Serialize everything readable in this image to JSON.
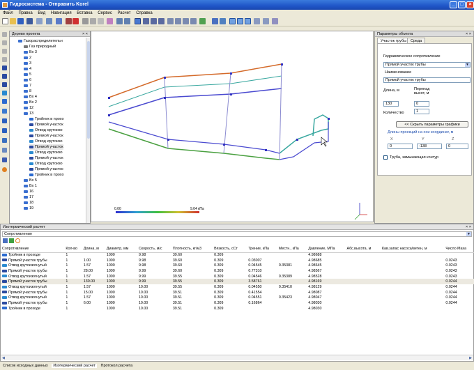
{
  "app": {
    "title": "Гидросистема - Отправить Korel",
    "menu": [
      "Файл",
      "Правка",
      "Вид",
      "Навигация",
      "Вставка",
      "Сервис",
      "Расчет",
      "Справка"
    ]
  },
  "colors": {
    "pipe_orange": "#d46a2a",
    "pipe_blue": "#4a4ad0",
    "pipe_teal": "#3aa8a0",
    "pipe_green": "#4aa040",
    "node": "#3030c0"
  },
  "tree": {
    "title": "Дерево проекта",
    "items": [
      {
        "label": "Газораспределительн",
        "icon": "network-icon",
        "color": "#3a6fd0"
      },
      {
        "label": "Газ природный",
        "icon": "gas-icon",
        "color": "#777"
      },
      {
        "label": "Вх 3",
        "icon": "branch-icon",
        "color": "#3a6fd0"
      },
      {
        "label": "2",
        "icon": "branch-icon",
        "color": "#3a6fd0"
      },
      {
        "label": "3",
        "icon": "branch-icon",
        "color": "#3a6fd0"
      },
      {
        "label": "4",
        "icon": "branch-icon",
        "color": "#3a6fd0"
      },
      {
        "label": "5",
        "icon": "branch-icon",
        "color": "#3a6fd0"
      },
      {
        "label": "6",
        "icon": "branch-icon",
        "color": "#3a6fd0"
      },
      {
        "label": "7",
        "icon": "branch-icon",
        "color": "#3a6fd0"
      },
      {
        "label": "8",
        "icon": "branch-icon",
        "color": "#3a6fd0"
      },
      {
        "label": "Вх 4",
        "icon": "branch-icon",
        "color": "#3a6fd0"
      },
      {
        "label": "Вх 2",
        "icon": "branch-icon",
        "color": "#3a6fd0"
      },
      {
        "label": "12",
        "icon": "branch-icon",
        "color": "#3a6fd0"
      },
      {
        "label": "13",
        "icon": "branch-icon",
        "color": "#3a6fd0"
      },
      {
        "label": "Тройник в прохо",
        "icon": "tee-icon",
        "color": "#2a6ad0"
      },
      {
        "label": "Прямой участок",
        "icon": "pipe-icon",
        "color": "#2a4aa0"
      },
      {
        "label": "Отвод крутоизо",
        "icon": "elbow-icon",
        "color": "#2a8ad0"
      },
      {
        "label": "Прямой участок",
        "icon": "pipe-icon",
        "color": "#2a4aa0"
      },
      {
        "label": "Отвод крутоизо",
        "icon": "elbow-icon",
        "color": "#2a8ad0"
      },
      {
        "label": "Прямой участок",
        "icon": "pipe-icon",
        "color": "#2a4aa0"
      },
      {
        "label": "Отвод крутоизо",
        "icon": "elbow-icon",
        "color": "#2a8ad0"
      },
      {
        "label": "Прямой участок",
        "icon": "pipe-icon",
        "color": "#2a4aa0"
      },
      {
        "label": "Отвод крутоизо",
        "icon": "elbow-icon",
        "color": "#2a8ad0"
      },
      {
        "label": "Прямой участок",
        "icon": "pipe-icon",
        "color": "#2a4aa0"
      },
      {
        "label": "Тройник в прохо",
        "icon": "tee-icon",
        "color": "#2a6ad0"
      },
      {
        "label": "Вх 5",
        "icon": "branch-icon",
        "color": "#3a6fd0"
      },
      {
        "label": "Вх 1",
        "icon": "branch-icon",
        "color": "#3a6fd0"
      },
      {
        "label": "16",
        "icon": "branch-icon",
        "color": "#3a6fd0"
      },
      {
        "label": "17",
        "icon": "branch-icon",
        "color": "#3a6fd0"
      },
      {
        "label": "18",
        "icon": "branch-icon",
        "color": "#3a6fd0"
      },
      {
        "label": "19",
        "icon": "branch-icon",
        "color": "#3a6fd0"
      }
    ]
  },
  "canvas": {
    "legend_min": "0.00",
    "legend_max": "9.04 кПа"
  },
  "props": {
    "title": "Параметры объекта",
    "tabs": [
      "Участок трубы",
      "Среда"
    ],
    "hydraulic_label": "Гидравлическое сопротивление",
    "hydraulic_value": "Прямой участок трубы",
    "name_label": "Наименование",
    "name_value": "Прямой участок трубы",
    "length_label": "Длина, м",
    "length_value": "130",
    "height_label": "Перепад высот, м",
    "height_value": "0",
    "count_label": "Количество",
    "count_value": "1",
    "hide_button": "<< Скрыть параметры графики",
    "proj_label": "Длины проекций на оси координат, м",
    "x_label": "X",
    "y_label": "Y",
    "z_label": "Z",
    "x_value": "0",
    "y_value": "-138",
    "z_value": "0",
    "closure_label": "Труба, замыкающая контур"
  },
  "results": {
    "title": "Изотермический расчет",
    "filter": "Сопротивления",
    "columns": [
      "Сопротивление",
      "Кол-во",
      "Длина, м",
      "Диаметр, мм",
      "Скорость, м/с",
      "Плотность, кг/м3",
      "Вязкость, сСт",
      "Трение, кПа",
      "Местн., кПа",
      "Давление, МПа",
      "Абс.высота, м",
      "Кав.запас насоса/ветен, м",
      "Число Маха"
    ],
    "rows": [
      {
        "cells": [
          "Тройник в проходе",
          "1",
          "",
          "1000",
          "9.98",
          "39.60",
          "0.309",
          "",
          "",
          "4.98688",
          "",
          "",
          ""
        ],
        "icon": "tee-icon",
        "color": "#2a6ad0",
        "sel": false
      },
      {
        "cells": [
          "Прямой участок трубы",
          "1",
          "1.00",
          "1000",
          "9.98",
          "39.60",
          "0.309",
          "0.03007",
          "",
          "4.98685",
          "",
          "",
          "0.0243"
        ],
        "icon": "pipe-icon",
        "color": "#2a4aa0",
        "sel": false
      },
      {
        "cells": [
          "Отвод крутоизогнутый",
          "1",
          "1.57",
          "1000",
          "9.98",
          "39.60",
          "0.309",
          "0.04545",
          "0.35381",
          "4.98645",
          "",
          "",
          "0.0243"
        ],
        "icon": "elbow-icon",
        "color": "#2a8ad0",
        "sel": false
      },
      {
        "cells": [
          "Прямой участок трубы",
          "1",
          "28.00",
          "1000",
          "9.99",
          "39.60",
          "0.309",
          "0.77310",
          "",
          "4.98567",
          "",
          "",
          "0.0243"
        ],
        "icon": "pipe-icon",
        "color": "#2a4aa0",
        "sel": false
      },
      {
        "cells": [
          "Отвод крутоизогнутый",
          "1",
          "1.57",
          "1000",
          "9.99",
          "39.55",
          "0.309",
          "0.04546",
          "0.35389",
          "4.98528",
          "",
          "",
          "0.0243"
        ],
        "icon": "elbow-icon",
        "color": "#2a8ad0",
        "sel": false
      },
      {
        "cells": [
          "Прямой участок трубы",
          "1",
          "130.00",
          "1000",
          "9.99",
          "39.55",
          "0.309",
          "3.58761",
          "",
          "4.98169",
          "",
          "",
          "0.0244"
        ],
        "icon": "pipe-icon",
        "color": "#2a4aa0",
        "sel": true
      },
      {
        "cells": [
          "Отвод крутоизогнутый",
          "1",
          "1.57",
          "1000",
          "10.00",
          "39.55",
          "0.309",
          "0.04550",
          "0.35410",
          "4.98129",
          "",
          "",
          "0.0244"
        ],
        "icon": "elbow-icon",
        "color": "#2a8ad0",
        "sel": false
      },
      {
        "cells": [
          "Прямой участок трубы",
          "1",
          "15.00",
          "1000",
          "10.00",
          "39.51",
          "0.309",
          "0.41554",
          "",
          "4.98087",
          "",
          "",
          "0.0244"
        ],
        "icon": "pipe-icon",
        "color": "#2a4aa0",
        "sel": false
      },
      {
        "cells": [
          "Отвод крутоизогнутый",
          "1",
          "1.57",
          "1000",
          "10.00",
          "39.51",
          "0.309",
          "0.04551",
          "0.35423",
          "4.98047",
          "",
          "",
          "0.0244"
        ],
        "icon": "elbow-icon",
        "color": "#2a8ad0",
        "sel": false
      },
      {
        "cells": [
          "Прямой участок трубы",
          "1",
          "6.00",
          "1000",
          "10.00",
          "39.51",
          "0.309",
          "0.16864",
          "",
          "4.98030",
          "",
          "",
          "0.0244"
        ],
        "icon": "pipe-icon",
        "color": "#2a4aa0",
        "sel": false
      },
      {
        "cells": [
          "Тройник в проходе",
          "1",
          "",
          "1000",
          "10.00",
          "39.51",
          "0.309",
          "",
          "",
          "4.98030",
          "",
          "",
          ""
        ],
        "icon": "tee-icon",
        "color": "#2a6ad0",
        "sel": false
      }
    ]
  },
  "status": {
    "tabs": [
      "Список исходных данных",
      "Изотермический расчет",
      "Протокол расчета"
    ]
  }
}
